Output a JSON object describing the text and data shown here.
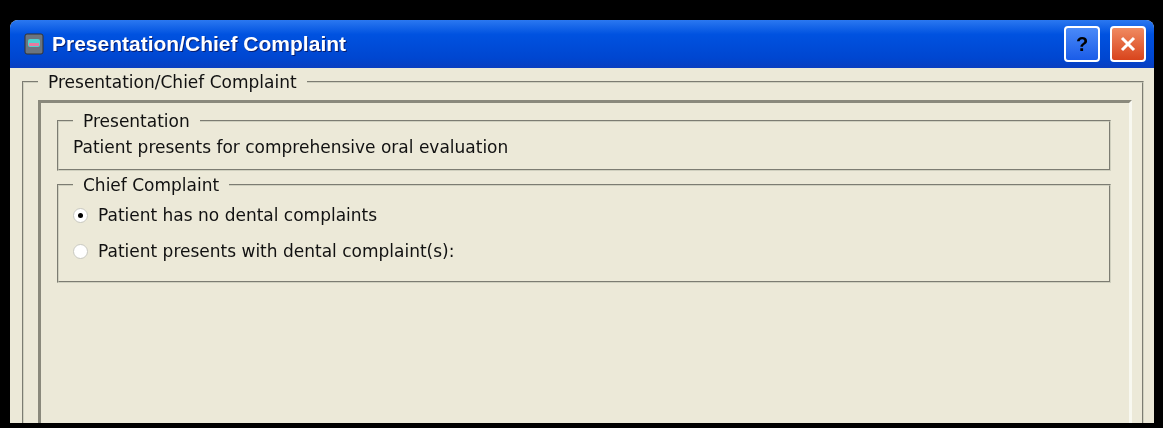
{
  "window": {
    "title": "Presentation/Chief Complaint",
    "buttons": [
      "?"
    ]
  },
  "outer_group": {
    "legend": "Presentation/Chief Complaint"
  },
  "presentation": {
    "legend": "Presentation",
    "text": "Patient presents for comprehensive oral evaluation"
  },
  "chief_complaint": {
    "legend": "Chief Complaint",
    "options": [
      {
        "label": "Patient has no dental complaints",
        "selected": true
      },
      {
        "label": "Patient presents with dental complaint(s):",
        "selected": false
      }
    ]
  }
}
